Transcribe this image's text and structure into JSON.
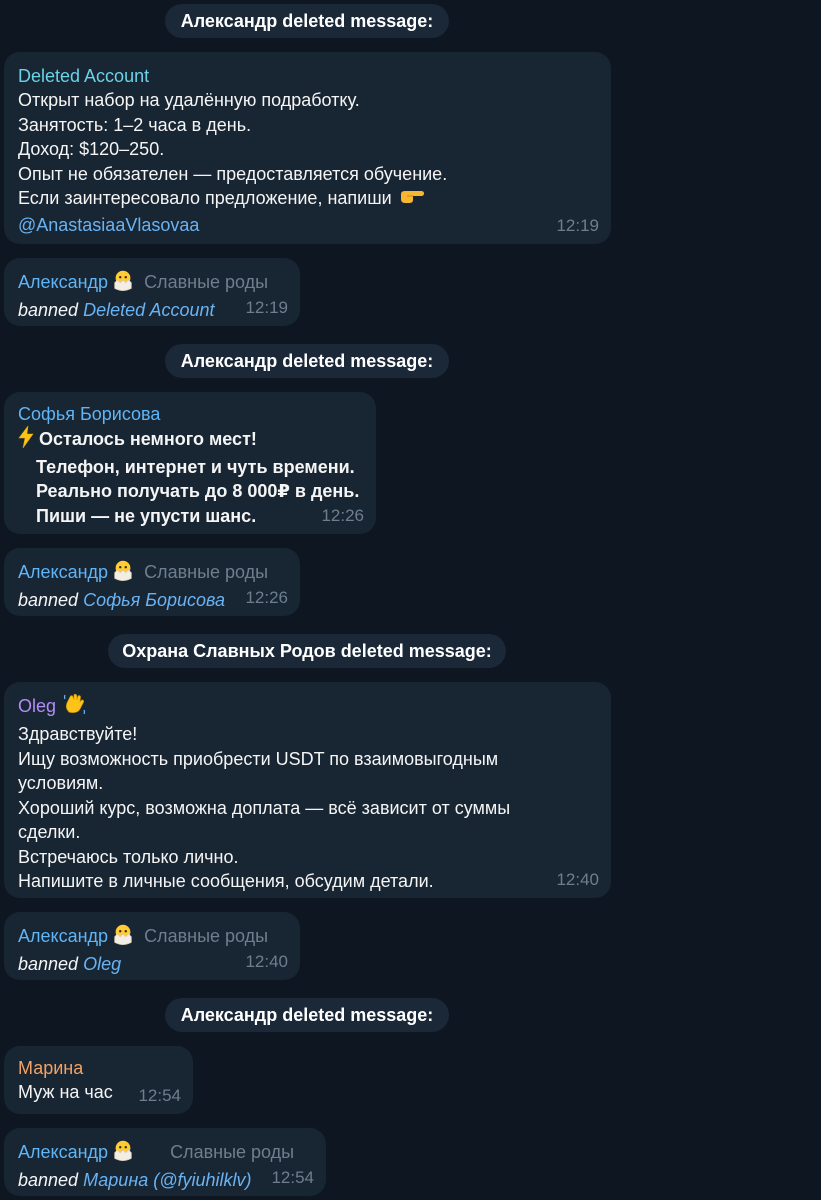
{
  "colors": {
    "background": "#0e1621",
    "bubble": "#182533",
    "service_pill": "#1b2838",
    "link": "#6ab3f3",
    "timestamp": "#6d7f8f"
  },
  "messages": {
    "svc1": "Александр deleted message:",
    "m1": {
      "sender": "Deleted Account",
      "lines": [
        "Открыт набор на удалённую подработку.",
        "Занятость: 1–2 часа в день.",
        "Доход: $120–250.",
        "Опыт не обязателен — предоставляется обучение.",
        "Если заинтересовало предложение, напиши"
      ],
      "emoji": "pointing-right-emoji",
      "link": "@AnastasiaaVlasovaa",
      "time": "12:19"
    },
    "b1": {
      "sender": "Александр",
      "emoji": "hatching-chick-emoji",
      "tag": "Славные роды",
      "action": "banned",
      "target": "Deleted Account",
      "time": "12:19"
    },
    "svc2": "Александр deleted message:",
    "m2": {
      "sender": "Софья Борисова",
      "emoji": "lightning-emoji",
      "lines": [
        "Осталось немного мест!",
        "Телефон, интернет и чуть времени.",
        "Реально получать до 8 000₽ в день.",
        "Пиши — не упусти шанс."
      ],
      "time": "12:26"
    },
    "b2": {
      "sender": "Александр",
      "emoji": "hatching-chick-emoji",
      "tag": "Славные роды",
      "action": "banned",
      "target": "Софья Борисова",
      "time": "12:26"
    },
    "svc3": "Охрана Славных Родов deleted message:",
    "m3": {
      "sender": "Oleg",
      "emoji": "waving-hand-emoji",
      "lines": [
        "Здравствуйте!",
        "Ищу возможность приобрести USDT по взаимовыгодным",
        "условиям.",
        "Хороший курс, возможна доплата — всё зависит от суммы",
        "сделки.",
        "Встречаюсь только лично.",
        "Напишите в личные сообщения, обсудим детали."
      ],
      "time": "12:40"
    },
    "b3": {
      "sender": "Александр",
      "emoji": "hatching-chick-emoji",
      "tag": "Славные роды",
      "action": "banned",
      "target": "Oleg",
      "time": "12:40"
    },
    "svc4": "Александр deleted message:",
    "m4": {
      "sender": "Марина",
      "lines": [
        "Муж на час"
      ],
      "time": "12:54"
    },
    "b4": {
      "sender": "Александр",
      "emoji": "hatching-chick-emoji",
      "tag": "Славные роды",
      "action": "banned",
      "target": "Марина",
      "target_handle": "(@fyiuhilklv)",
      "time": "12:54"
    }
  }
}
